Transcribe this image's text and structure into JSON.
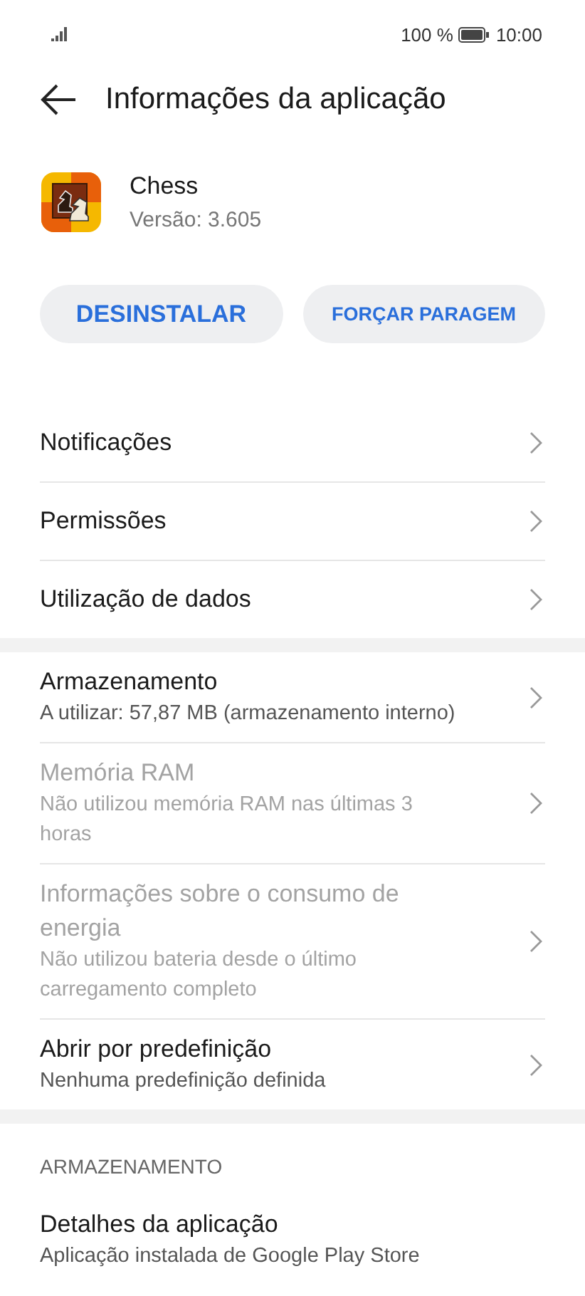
{
  "status_bar": {
    "battery": "100 %",
    "time": "10:00"
  },
  "header": {
    "title": "Informações da aplicação"
  },
  "app": {
    "name": "Chess",
    "version": "Versão: 3.605"
  },
  "buttons": [
    {
      "label": "DESINSTALAR",
      "kind": "large"
    },
    {
      "label": "FORÇAR PARAGEM",
      "kind": "small"
    }
  ],
  "groups": [
    {
      "items": [
        {
          "title": "Notificações",
          "disabled": false
        },
        {
          "title": "Permissões",
          "disabled": false
        },
        {
          "title": "Utilização de dados",
          "disabled": false
        }
      ]
    },
    {
      "items": [
        {
          "title": "Armazenamento",
          "subtitle": "A utilizar: 57,87 MB (armazenamento interno)",
          "disabled": false
        },
        {
          "title": "Memória RAM",
          "subtitle": "Não utilizou memória RAM nas últimas 3 horas",
          "disabled": true
        },
        {
          "title": "Informações sobre o consumo de energia",
          "subtitle": "Não utilizou bateria desde o último carregamento completo",
          "disabled": true
        },
        {
          "title": "Abrir por predefinição",
          "subtitle": "Nenhuma predefinição definida",
          "disabled": false
        }
      ]
    },
    {
      "header": "ARMAZENAMENTO",
      "items": [
        {
          "title": "Detalhes da aplicação",
          "subtitle": "Aplicação instalada de Google Play Store",
          "disabled": false
        }
      ]
    }
  ]
}
